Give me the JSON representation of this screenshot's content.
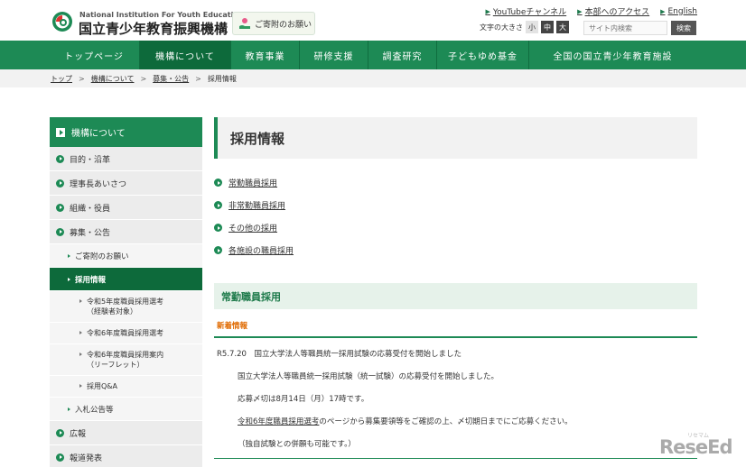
{
  "header": {
    "org_en": "National Institution For Youth Education",
    "org_ja": "国立青少年教育振興機構",
    "donate_label": "ご寄附のお願い",
    "top_links": [
      "YouTubeチャンネル",
      "本部へのアクセス",
      "English"
    ],
    "font_size_label": "文字の大きさ",
    "font_sizes": [
      "小",
      "中",
      "大"
    ],
    "font_size_selected": "中",
    "search_placeholder": "サイト内検索",
    "search_button": "検索",
    "brand_color": "#1d8a55"
  },
  "nav": {
    "items": [
      "トップページ",
      "機構について",
      "教育事業",
      "研修支援",
      "調査研究",
      "子どもゆめ基金",
      "全国の国立青少年教育施設"
    ],
    "active": "機構について"
  },
  "breadcrumb": [
    "トップ",
    "機構について",
    "募集・公告",
    "採用情報"
  ],
  "sidebar": {
    "heading": "機構について",
    "items": [
      {
        "level": 1,
        "label": "目的・沿革"
      },
      {
        "level": 1,
        "label": "理事長あいさつ"
      },
      {
        "level": 1,
        "label": "組織・役員"
      },
      {
        "level": 1,
        "label": "募集・公告"
      },
      {
        "level": 2,
        "label": "ご寄附のお願い"
      },
      {
        "level": 2,
        "label": "採用情報",
        "active": true
      },
      {
        "level": 3,
        "label": "令和5年度職員採用選考\n（経験者対象）"
      },
      {
        "level": 3,
        "label": "令和6年度職員採用選考"
      },
      {
        "level": 3,
        "label": "令和6年度職員採用案内\n（リーフレット）"
      },
      {
        "level": 3,
        "label": "採用Q&A"
      },
      {
        "level": 2,
        "label": "入札公告等"
      },
      {
        "level": 1,
        "label": "広報"
      },
      {
        "level": 1,
        "label": "報道発表"
      }
    ]
  },
  "main": {
    "title": "採用情報",
    "anchors": [
      "常勤職員採用",
      "非常勤職員採用",
      "その他の採用",
      "各施設の職員採用"
    ],
    "section_title": "常勤職員採用",
    "news_label": "新着情報",
    "news_line1": "R5.7.20　国立大学法人等職員統一採用試験の応募受付を開始しました",
    "news_line2": "国立大学法人等職員統一採用試験（統一試験）の応募受付を開始しました。",
    "news_line3": "応募〆切は8月14日（月）17時です。",
    "news_line4_link": "令和6年度職員採用選考",
    "news_line4_rest": "のページから募集要領等をご確認の上、〆切期日までにご応募ください。",
    "news_line5": "（独自試験との併願も可能です。）"
  },
  "watermark": {
    "main": "ReseEd",
    "sub": "リセマム"
  }
}
